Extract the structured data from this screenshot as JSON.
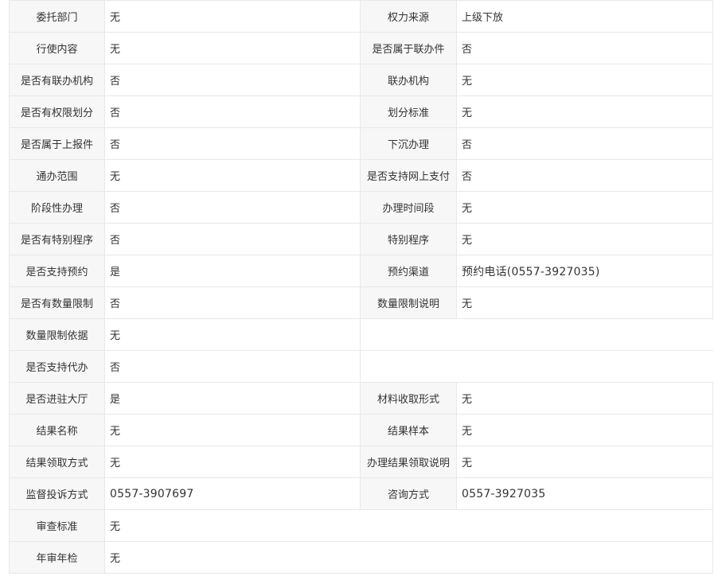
{
  "rows": [
    {
      "l1": "委托部门",
      "v1": "无",
      "l2": "权力来源",
      "v2": "上级下放"
    },
    {
      "l1": "行使内容",
      "v1": "无",
      "l2": "是否属于联办件",
      "v2": "否"
    },
    {
      "l1": "是否有联办机构",
      "v1": "否",
      "l2": "联办机构",
      "v2": "无"
    },
    {
      "l1": "是否有权限划分",
      "v1": "否",
      "l2": "划分标准",
      "v2": "无"
    },
    {
      "l1": "是否属于上报件",
      "v1": "否",
      "l2": "下沉办理",
      "v2": "否"
    },
    {
      "l1": "通办范围",
      "v1": "无",
      "l2": "是否支持网上支付",
      "v2": "否"
    },
    {
      "l1": "阶段性办理",
      "v1": "否",
      "l2": "办理时间段",
      "v2": "无"
    },
    {
      "l1": "是否有特别程序",
      "v1": "否",
      "l2": "特别程序",
      "v2": "无"
    },
    {
      "l1": "是否支持预约",
      "v1": "是",
      "l2": "预约渠道",
      "v2": "预约电话(0557-3927035)"
    },
    {
      "l1": "是否有数量限制",
      "v1": "否",
      "l2": "数量限制说明",
      "v2": "无"
    },
    {
      "l1": "数量限制依据",
      "v1": "无"
    },
    {
      "l1": "是否支持代办",
      "v1": "否"
    },
    {
      "l1": "是否进驻大厅",
      "v1": "是",
      "l2": "材料收取形式",
      "v2": "无"
    },
    {
      "l1": "结果名称",
      "v1": "无",
      "l2": "结果样本",
      "v2": "无"
    },
    {
      "l1": "结果领取方式",
      "v1": "无",
      "l2": "办理结果领取说明",
      "v2": "无"
    },
    {
      "l1": "监督投诉方式",
      "v1": "0557-3907697",
      "l2": "咨询方式",
      "v2": "0557-3927035"
    },
    {
      "l1": "审查标准",
      "v1": "无"
    },
    {
      "l1": "年审年检",
      "v1": "无"
    }
  ]
}
